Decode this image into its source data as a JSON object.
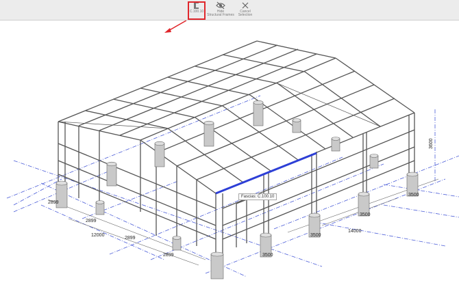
{
  "toolbar": {
    "profile_button": {
      "label": "C.100.10",
      "icon": "profile-c-icon"
    },
    "hide_button": {
      "label": "Hide\nStructural Frames",
      "icon": "eye-slash-icon"
    },
    "cancel_button": {
      "label": "Cancel\nSelection",
      "icon": "close-icon"
    }
  },
  "tooltip": {
    "text": "Fascias: C.100.10"
  },
  "dimensions": {
    "d1": "2899",
    "d2": "2899",
    "d3": "12000",
    "d4": "2899",
    "d5": "2899",
    "d6": "3500",
    "d7": "3500",
    "d8": "3500",
    "d9": "3500",
    "d10": "14000",
    "d11": "3600"
  },
  "colors": {
    "selection": "#2d3fd6",
    "grid": "#4a5cd8",
    "annotation": "#e0262b",
    "steel": "#555555"
  }
}
